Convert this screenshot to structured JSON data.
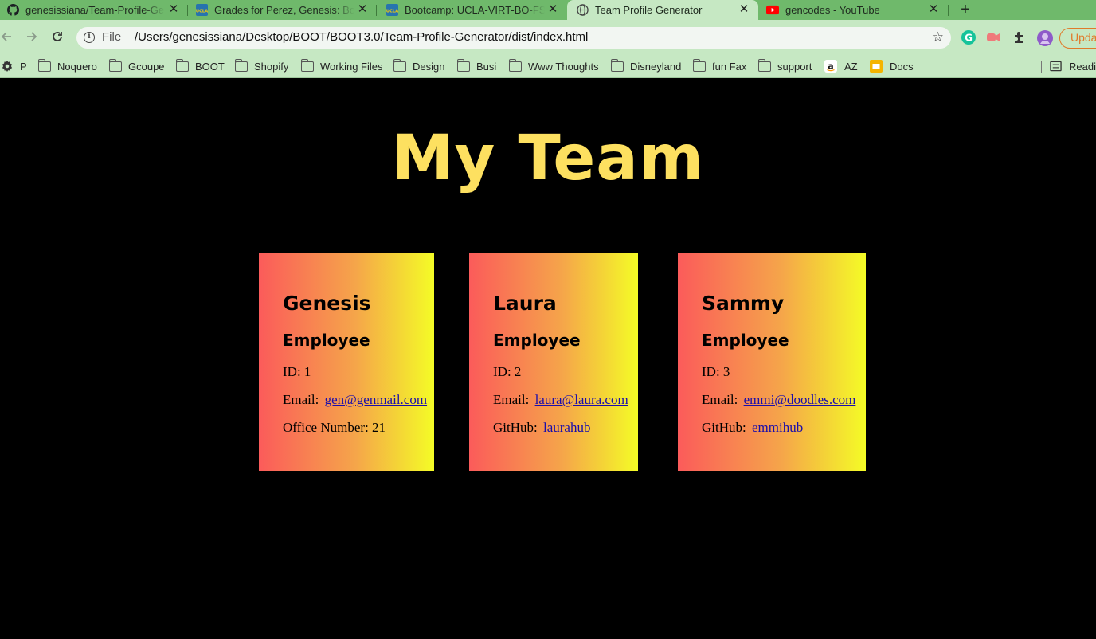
{
  "browser": {
    "tabs": [
      {
        "title": "genesissiana/Team-Profile-Generator",
        "icon": "github-icon"
      },
      {
        "title": "Grades for Perez, Genesis: Bootcamp",
        "icon": "ucla-icon"
      },
      {
        "title": "Bootcamp: UCLA-VIRT-BO-FSF",
        "icon": "ucla-icon"
      },
      {
        "title": "Team Profile Generator",
        "icon": "globe-icon"
      },
      {
        "title": "gencodes - YouTube",
        "icon": "youtube-icon"
      }
    ],
    "new_tab_label": "+",
    "close_glyph": "✕",
    "address": {
      "scheme": "File",
      "url": "/Users/genesissiana/Desktop/BOOT/BOOT3.0/Team-Profile-Generator/dist/index.html"
    },
    "update_label": "Update",
    "bookmarks": [
      {
        "label": "P",
        "icon": "gear-icon"
      },
      {
        "label": "Noquero",
        "icon": "folder-icon"
      },
      {
        "label": "Gcoupe",
        "icon": "folder-icon"
      },
      {
        "label": "BOOT",
        "icon": "folder-icon"
      },
      {
        "label": "Shopify",
        "icon": "folder-icon"
      },
      {
        "label": "Working Files",
        "icon": "folder-icon"
      },
      {
        "label": "Design",
        "icon": "folder-icon"
      },
      {
        "label": "Busi",
        "icon": "folder-icon"
      },
      {
        "label": "Www Thoughts",
        "icon": "folder-icon"
      },
      {
        "label": "Disneyland",
        "icon": "folder-icon"
      },
      {
        "label": "fun Fax",
        "icon": "folder-icon"
      },
      {
        "label": "support",
        "icon": "folder-icon"
      },
      {
        "label": "AZ",
        "icon": "amazon-icon"
      },
      {
        "label": "Docs",
        "icon": "slides-icon"
      }
    ],
    "reading_list_label": "Reading list"
  },
  "page": {
    "heading": "My Team",
    "cards": [
      {
        "name": "Genesis",
        "role": "Employee",
        "id_label": "ID: 1",
        "email_label": "Email:",
        "email": "gen@genmail.com",
        "extra_label": "Office Number: 21",
        "extra_link": ""
      },
      {
        "name": "Laura",
        "role": "Employee",
        "id_label": "ID: 2",
        "email_label": "Email:",
        "email": "laura@laura.com",
        "extra_label": "GitHub:",
        "extra_link": "laurahub"
      },
      {
        "name": "Sammy",
        "role": "Employee",
        "id_label": "ID: 3",
        "email_label": "Email:",
        "email": "emmi@doodles.com",
        "extra_label": "GitHub:",
        "extra_link": "emmihub"
      }
    ]
  },
  "colors": {
    "heading": "#fde060",
    "card_gradient": [
      "#fb5b5a",
      "#f5a54a",
      "#f4fc26"
    ],
    "link": "#1a0dab",
    "tabstrip": "#6fb96b",
    "toolbar": "#c6e8c3"
  }
}
